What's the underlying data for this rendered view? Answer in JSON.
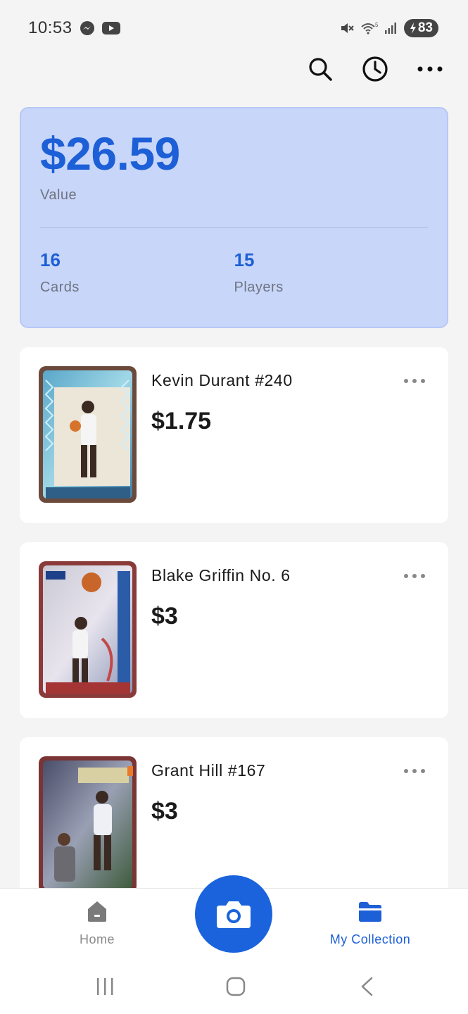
{
  "status_bar": {
    "time": "10:53",
    "battery": "83"
  },
  "summary": {
    "total_value": "$26.59",
    "value_label": "Value",
    "cards_count": "16",
    "cards_label": "Cards",
    "players_count": "15",
    "players_label": "Players"
  },
  "cards": [
    {
      "name": "Kevin Durant #240",
      "price": "$1.75"
    },
    {
      "name": "Blake Griffin No. 6",
      "price": "$3"
    },
    {
      "name": "Grant Hill #167",
      "price": "$3"
    }
  ],
  "nav": {
    "home_label": "Home",
    "collection_label": "My Collection"
  },
  "colors": {
    "accent": "#1d5fd6",
    "summary_bg": "#c8d6fa",
    "page_bg": "#f4f4f5"
  },
  "icons": [
    "messenger-icon",
    "youtube-icon",
    "mute-icon",
    "wifi-icon",
    "signal-icon",
    "search-icon",
    "history-icon",
    "more-icon",
    "home-icon",
    "camera-icon",
    "folder-icon"
  ]
}
